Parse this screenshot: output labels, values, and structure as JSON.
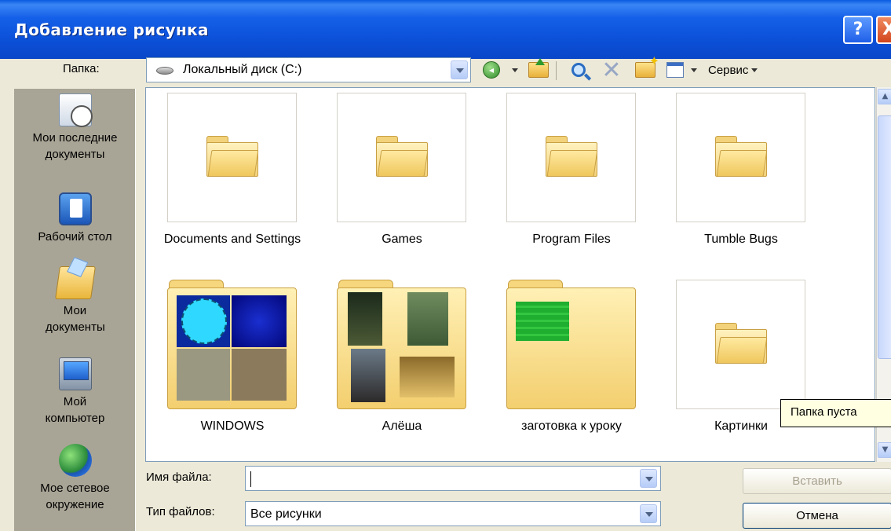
{
  "window": {
    "title": "Добавление рисунка",
    "help_glyph": "?",
    "close_glyph": "X"
  },
  "toolbar": {
    "folder_label": "Папка:",
    "folder_value": "Локальный диск (C:)",
    "tools_label": "Сервис",
    "back_glyph": "◂",
    "delete_glyph": "✕"
  },
  "places": [
    {
      "label": "Мои последние документы",
      "icon": "recent-documents-icon"
    },
    {
      "label": "Рабочий стол",
      "icon": "desktop-icon"
    },
    {
      "label": "Мои документы",
      "icon": "my-documents-icon"
    },
    {
      "label": "Мой компьютер",
      "icon": "my-computer-icon"
    },
    {
      "label": "Мое сетевое окружение",
      "icon": "network-icon"
    }
  ],
  "files": [
    {
      "name": "Documents and Settings",
      "kind": "folder"
    },
    {
      "name": "Games",
      "kind": "folder"
    },
    {
      "name": "Program Files",
      "kind": "folder"
    },
    {
      "name": "Tumble Bugs",
      "kind": "folder"
    },
    {
      "name": "WINDOWS",
      "kind": "folder-thumbnails"
    },
    {
      "name": "Алёша",
      "kind": "folder-thumbnails"
    },
    {
      "name": "заготовка к уроку",
      "kind": "folder-thumbnails"
    },
    {
      "name": "Картинки",
      "kind": "folder"
    }
  ],
  "tooltip": "Папка пуста",
  "filename": {
    "label": "Имя файла:",
    "value": ""
  },
  "filetype": {
    "label": "Тип файлов:",
    "value": "Все рисунки"
  },
  "buttons": {
    "insert": "Вставить",
    "cancel": "Отмена"
  },
  "scrollbar": {
    "up_glyph": "▲",
    "down_glyph": "▼"
  }
}
